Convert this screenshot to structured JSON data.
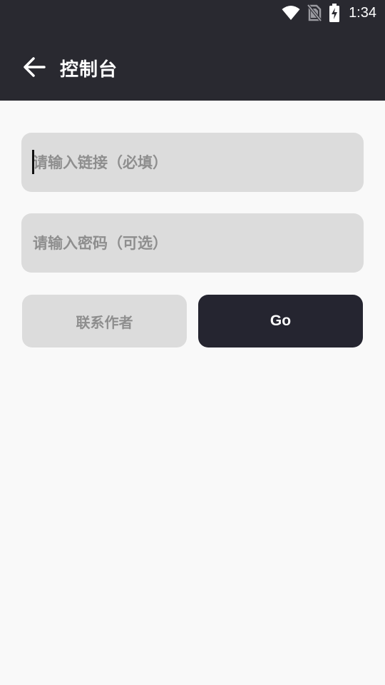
{
  "status_bar": {
    "time": "1:34",
    "icons": [
      "wifi-icon",
      "no-sim-icon",
      "battery-charging-icon"
    ]
  },
  "toolbar": {
    "back_icon": "arrow-back-icon",
    "title": "控制台"
  },
  "form": {
    "link_placeholder": "请输入链接（必填）",
    "link_value": "",
    "password_placeholder": "请输入密码（可选）",
    "password_value": ""
  },
  "buttons": {
    "contact_label": "联系作者",
    "go_label": "Go"
  },
  "colors": {
    "header_bg": "#292930",
    "page_bg": "#f9f9f9",
    "field_bg": "#dcdcdc",
    "placeholder": "#8e8e8e",
    "go_button_bg": "#252530"
  }
}
